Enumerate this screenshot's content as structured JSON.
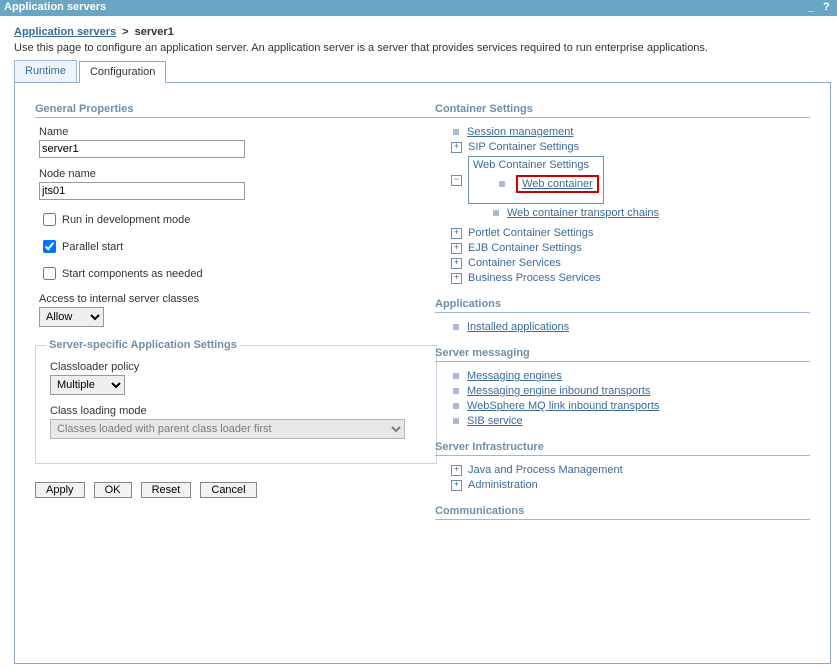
{
  "window_title": "Application servers",
  "breadcrumb": {
    "root": "Application servers",
    "sep": ">",
    "current": "server1"
  },
  "page_desc": "Use this page to configure an application server. An application server is a server that provides services required to run enterprise applications.",
  "tabs": {
    "runtime": "Runtime",
    "configuration": "Configuration"
  },
  "general": {
    "header": "General Properties",
    "name_label": "Name",
    "name_value": "server1",
    "node_label": "Node name",
    "node_value": "jts01",
    "dev_mode": "Run in development mode",
    "parallel_start": "Parallel start",
    "start_components": "Start components as needed",
    "access_label": "Access to internal server classes",
    "access_value": "Allow"
  },
  "server_specific": {
    "legend": "Server-specific Application Settings",
    "classloader_label": "Classloader policy",
    "classloader_value": "Multiple",
    "loading_mode_label": "Class loading mode",
    "loading_mode_value": "Classes loaded with parent class loader first"
  },
  "buttons": {
    "apply": "Apply",
    "ok": "OK",
    "reset": "Reset",
    "cancel": "Cancel"
  },
  "right": {
    "container": {
      "header": "Container Settings",
      "session": "Session management",
      "sip": "SIP Container Settings",
      "web_settings": "Web Container Settings",
      "web_container": "Web container",
      "web_transport": "Web container transport chains",
      "portlet": "Portlet Container Settings",
      "ejb": "EJB Container Settings",
      "services": "Container Services",
      "bps": "Business Process Services"
    },
    "applications": {
      "header": "Applications",
      "installed": "Installed applications"
    },
    "messaging": {
      "header": "Server messaging",
      "engines": "Messaging engines",
      "inbound": "Messaging engine inbound transports",
      "mq": "WebSphere MQ link inbound transports",
      "sib": "SIB service"
    },
    "infra": {
      "header": "Server Infrastructure",
      "java": "Java and Process Management",
      "admin": "Administration"
    },
    "communications": {
      "header": "Communications"
    }
  }
}
